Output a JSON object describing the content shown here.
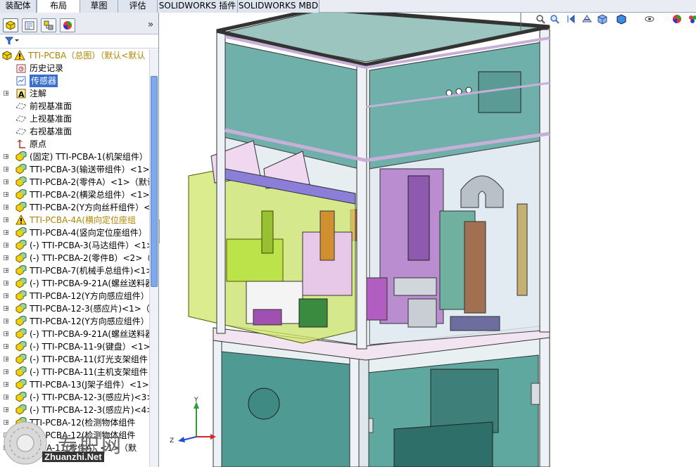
{
  "tabs": [
    {
      "label": "装配体",
      "active": false
    },
    {
      "label": "布局",
      "active": true
    },
    {
      "label": "草图",
      "active": false
    },
    {
      "label": "评估",
      "active": false
    },
    {
      "label": "SOLIDWORKS 插件",
      "active": false
    },
    {
      "label": "SOLIDWORKS MBD",
      "active": false
    }
  ],
  "manager_tabs": [
    "feature-manager",
    "property-manager",
    "configuration-manager",
    "display-manager"
  ],
  "manager_more": "»",
  "tree": {
    "root": {
      "label": "TTI-PCBA（总图）（默认<默认"
    },
    "items": [
      {
        "label": "历史记录",
        "icon": "history-icon"
      },
      {
        "label": "传感器",
        "icon": "sensor-icon",
        "selected": true
      },
      {
        "label": "注解",
        "icon": "annotation-icon",
        "expander": true
      },
      {
        "label": "前视基准面",
        "icon": "plane-icon"
      },
      {
        "label": "上视基准面",
        "icon": "plane-icon"
      },
      {
        "label": "右视基准面",
        "icon": "plane-icon"
      },
      {
        "label": "原点",
        "icon": "origin-icon"
      },
      {
        "label": "(固定) TTI-PCBA-1(机架组件）",
        "icon": "subassembly-icon",
        "expander": true
      },
      {
        "label": "TTI-PCBA-3(输送带组件）<1>",
        "icon": "subassembly-icon",
        "expander": true
      },
      {
        "label": "TTI-PCBA-2(零件A）<1>（默认",
        "icon": "subassembly-icon",
        "expander": true
      },
      {
        "label": "TTI-PCBA-2(横梁总组件）<1>",
        "icon": "subassembly-icon",
        "expander": true
      },
      {
        "label": "TTI-PCBA-2(Y方向丝杆组件）<",
        "icon": "subassembly-icon",
        "expander": true
      },
      {
        "label": "TTI-PCBA-4A(横向定位座组",
        "icon": "warning-icon",
        "expander": true,
        "warning": true
      },
      {
        "label": "TTI-PCBA-4(竖向定位座组件）",
        "icon": "subassembly-icon",
        "expander": true
      },
      {
        "label": "(-) TTI-PCBA-3(马达组件）<1>",
        "icon": "subassembly-icon",
        "expander": true
      },
      {
        "label": "(-) TTI-PCBA-2(零件B）<2>（默",
        "icon": "subassembly-icon",
        "expander": true
      },
      {
        "label": "TTI-PCBA-7(机械手总组件)<1>",
        "icon": "subassembly-icon",
        "expander": true
      },
      {
        "label": "(-) TTI-PCBA-9-21A(螺丝送料器",
        "icon": "subassembly-icon",
        "expander": true
      },
      {
        "label": "TTI-PCBA-12(Y方向感应组件）",
        "icon": "subassembly-icon",
        "expander": true
      },
      {
        "label": "TTI-PCBA-12-3(感应片)<1>（默",
        "icon": "subassembly-icon",
        "expander": true
      },
      {
        "label": "TTI-PCBA-12(Y方向感应组件）",
        "icon": "subassembly-icon",
        "expander": true
      },
      {
        "label": "(-) TTI-PCBA-9-21A(螺丝送料器",
        "icon": "subassembly-icon",
        "expander": true
      },
      {
        "label": "(-) TTI-PCBA-11-9(键盘）<1>",
        "icon": "subassembly-icon",
        "expander": true
      },
      {
        "label": "(-) TTI-PCBA-11(灯光支架组件",
        "icon": "subassembly-icon",
        "expander": true
      },
      {
        "label": "(-) TTI-PCBA-11(主机支架组件",
        "icon": "subassembly-icon",
        "expander": true
      },
      {
        "label": "TTI-PCBA-13(J架子组件）<1>",
        "icon": "subassembly-icon",
        "expander": true
      },
      {
        "label": "(-) TTI-PCBA-12-3(感应片)<3>",
        "icon": "subassembly-icon",
        "expander": true
      },
      {
        "label": "(-) TTI-PCBA-12-3(感应片)<4>",
        "icon": "subassembly-icon",
        "expander": true
      },
      {
        "label": "TTI-PCBA-12(检测物体组件",
        "icon": "subassembly-icon",
        "expander": true
      },
      {
        "label": "TTI-PCBA-12(检测物体组件",
        "icon": "subassembly-icon",
        "expander": true
      },
      {
        "label": "PCBA-11(零件A）<1>（默",
        "icon": "subassembly-icon",
        "expander": true
      }
    ]
  },
  "watermark": {
    "cn": "专职网",
    "url": "Zhuanzhi.Net"
  },
  "colors": {
    "selection": "#3a6fcf",
    "warning": "#e0a800",
    "assembly_yellow": "#f0d000",
    "glass": "#5fa8a0"
  }
}
